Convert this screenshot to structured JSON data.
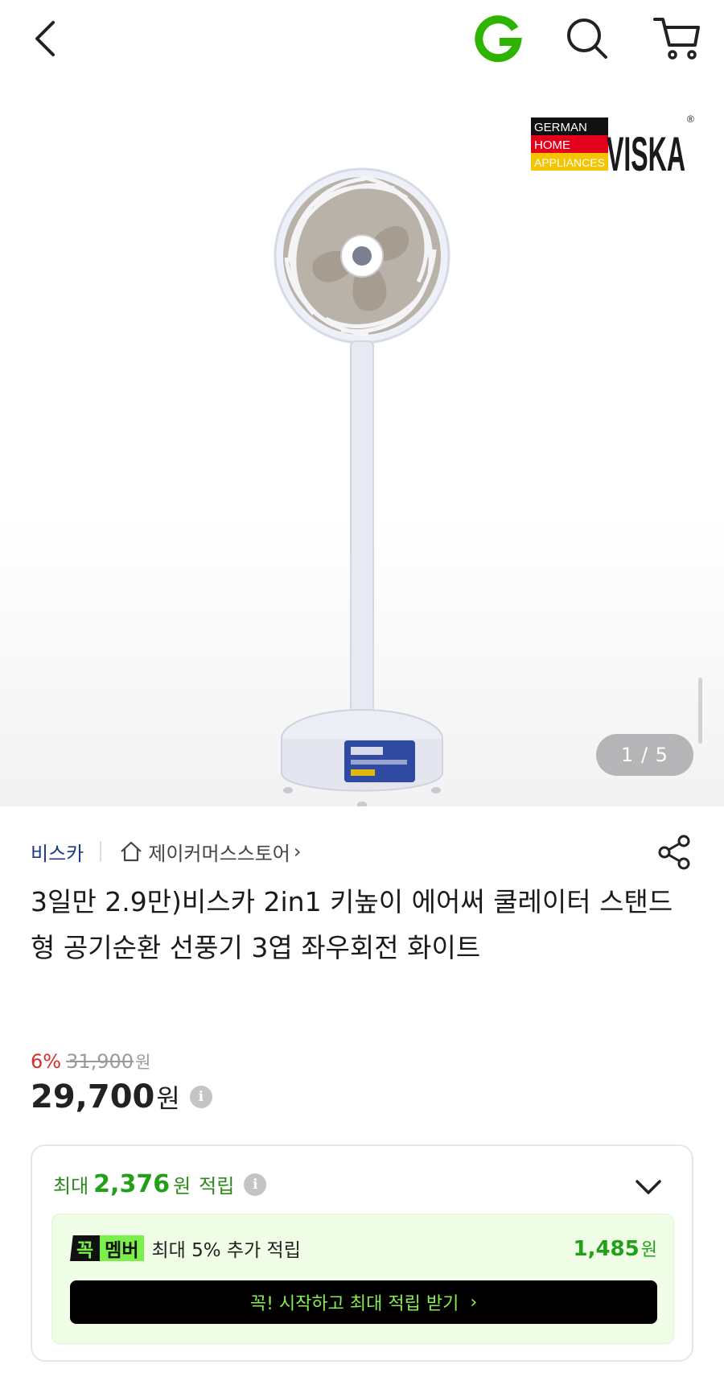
{
  "header": {
    "back_icon": "chevron-left-icon",
    "g_logo_letter": "G",
    "search_icon": "search-icon",
    "cart_icon": "cart-icon",
    "brand_color": "#2db400"
  },
  "gallery": {
    "brand_logo": {
      "line1": "GERMAN",
      "line2": "HOME",
      "line3": "APPLIANCES",
      "wordmark": "VISKA",
      "registered": "®"
    },
    "counter": "1 / 5"
  },
  "seller": {
    "brand": "비스카",
    "store": "제이커머스스토어",
    "store_chevron": "›"
  },
  "product": {
    "title": "3일만 2.9만)비스카 2in1 키높이 에어써 쿨레이터 스탠드형 공기순환 선풍기 3엽 좌우회전 화이트",
    "discount": "6%",
    "original_price": "31,900",
    "original_unit": "원",
    "price": "29,700",
    "price_unit": "원",
    "info_glyph": "i"
  },
  "points": {
    "prefix": "최대",
    "amount": "2,376",
    "unit": "원",
    "suffix": "적립",
    "info_glyph": "i",
    "member": {
      "badge_part1": "꼭",
      "badge_part2": "멤버",
      "text": "최대 5% 추가 적립",
      "amount": "1,485",
      "unit": "원"
    },
    "cta_label": "꼭! 시작하고 최대 적립 받기",
    "cta_arrow": "›"
  }
}
